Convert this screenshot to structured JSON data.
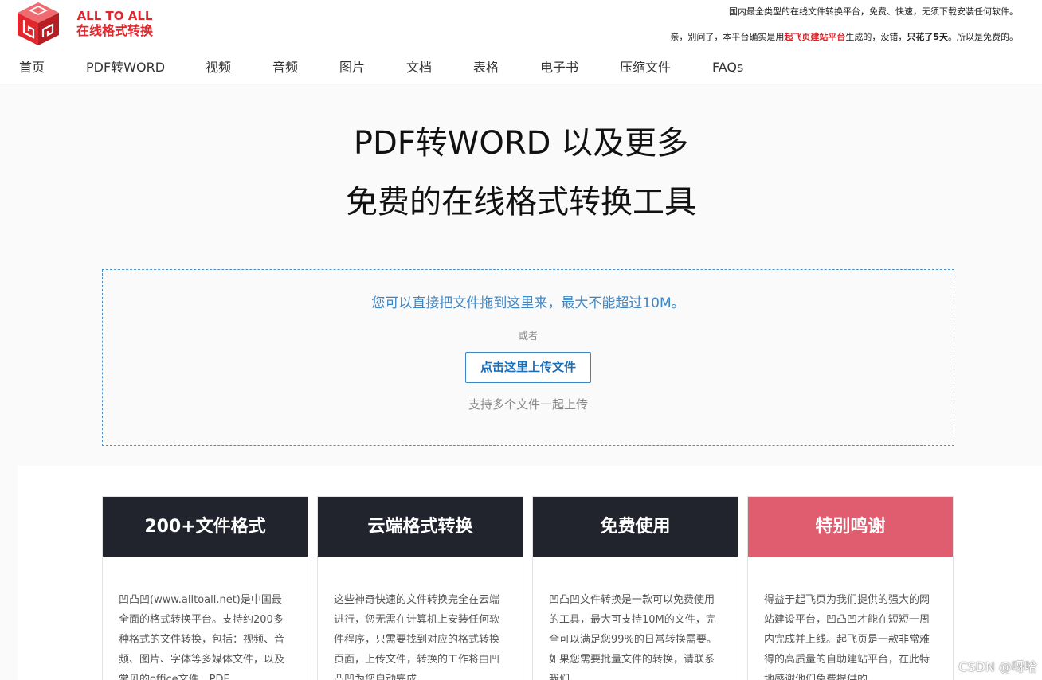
{
  "logo": {
    "en": "ALL TO ALL",
    "cn": "在线格式转换"
  },
  "notice": {
    "line1": "国内最全类型的在线文件转换平台，免费、快速，无须下载安装任何软件。",
    "line2_a": "亲，别问了，本平台确实是用",
    "line2_highlight": "起飞页建站平台",
    "line2_b": "生成的，没错，",
    "line2_bold": "只花了5天",
    "line2_c": "。所以是免费的。"
  },
  "nav": [
    {
      "label": "首页"
    },
    {
      "label": "PDF转WORD"
    },
    {
      "label": "视频"
    },
    {
      "label": "音频"
    },
    {
      "label": "图片"
    },
    {
      "label": "文档"
    },
    {
      "label": "表格"
    },
    {
      "label": "电子书"
    },
    {
      "label": "压缩文件"
    },
    {
      "label": "FAQs"
    }
  ],
  "hero": {
    "line1": "PDF转WORD 以及更多",
    "line2": "免费的在线格式转换工具"
  },
  "upload": {
    "drag_text": "您可以直接把文件拖到这里来，最大不能超过10M。",
    "or_text": "或者",
    "button_label": "点击这里上传文件",
    "multi_text": "支持多个文件一起上传"
  },
  "features": [
    {
      "title": "200+文件格式",
      "body": "凹凸凹(www.alltoall.net)是中国最全面的格式转换平台。支持约200多种格式的文件转换，包括：视频、音频、图片、字体等多媒体文件，以及常见的office文件，PDF"
    },
    {
      "title": "云端格式转换",
      "body": "这些神奇快速的文件转换完全在云端进行，您无需在计算机上安装任何软件程序，只需要找到对应的格式转换页面，上传文件，转换的工作将由凹凸凹为您自动完成。"
    },
    {
      "title": "免费使用",
      "body": "凹凸凹文件转换是一款可以免费使用的工具，最大可支持10M的文件，完全可以满足您99%的日常转换需要。如果您需要批量文件的转换，请联系我们。"
    },
    {
      "title": "特别鸣谢",
      "body": "得益于起飞页为我们提供的强大的网站建设平台，凹凸凹才能在短短一周内完成并上线。起飞页是一款非常难得的高质量的自助建站平台，在此特地感谢他们免费提供的"
    }
  ],
  "watermark": "CSDN @呀哈",
  "colors": {
    "brand_red": "#e1262e",
    "link_blue": "#3d86c5",
    "card_dark": "#21232d",
    "card_pink": "#e05d6f"
  }
}
